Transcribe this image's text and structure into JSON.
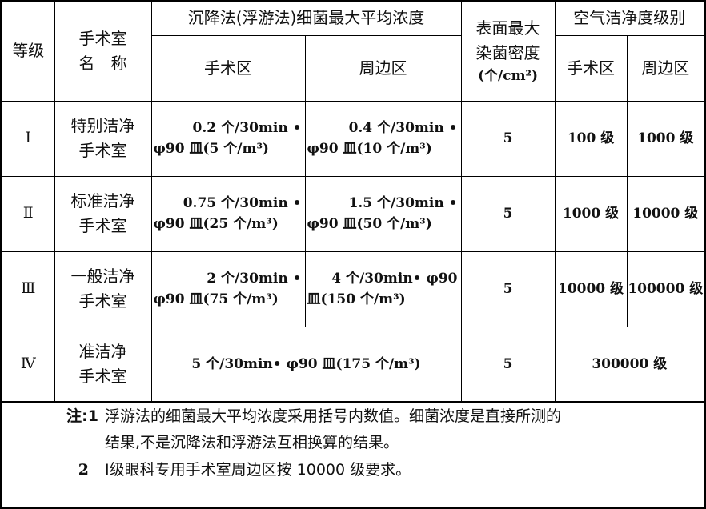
{
  "header": {
    "grade": "等级",
    "room_name_line1": "手术室",
    "room_name_line2": "名　称",
    "bacteria_conc": "沉降法(浮游法)细菌最大平均浓度",
    "op_zone": "手术区",
    "peri_zone": "周边区",
    "surface_line1": "表面最大",
    "surface_line2": "染菌密度",
    "surface_unit": "(个/cm²)",
    "air_clean": "空气洁净度级别",
    "air_op": "手术区",
    "air_peri": "周边区"
  },
  "rows": [
    {
      "grade": "Ⅰ",
      "name_line1": "特别洁净",
      "name_line2": "手术室",
      "op_line1": "0.2 个/30min •",
      "op_line2": "φ90 皿(5 个/m³)",
      "peri_line1": "0.4 个/30min •",
      "peri_line2": "φ90 皿(10 个/m³)",
      "surface": "5",
      "air_op": "100 级",
      "air_peri": "1000 级"
    },
    {
      "grade": "Ⅱ",
      "name_line1": "标准洁净",
      "name_line2": "手术室",
      "op_line1": "0.75 个/30min •",
      "op_line2": "φ90 皿(25 个/m³)",
      "peri_line1": "1.5 个/30min •",
      "peri_line2": "φ90 皿(50 个/m³)",
      "surface": "5",
      "air_op": "1000 级",
      "air_peri": "10000 级"
    },
    {
      "grade": "Ⅲ",
      "name_line1": "一般洁净",
      "name_line2": "手术室",
      "op_line1": "2 个/30min •",
      "op_line2": "φ90 皿(75 个/m³)",
      "peri_line1": "4 个/30min• φ90",
      "peri_line2": "皿(150 个/m³)",
      "surface": "5",
      "air_op": "10000 级",
      "air_peri": "100000 级"
    },
    {
      "grade": "Ⅳ",
      "name_line1": "准洁净",
      "name_line2": "手术室",
      "merged_conc": "5 个/30min• φ90 皿(175 个/m³)",
      "surface": "5",
      "air_merged": "300000 级"
    }
  ],
  "notes": {
    "prefix": "注:1",
    "note1_line1": "浮游法的细菌最大平均浓度采用括号内数值。细菌浓度是直接所测的",
    "note1_line2": "结果,不是沉降法和浮游法互相换算的结果。",
    "num2": "2",
    "note2": "Ⅰ级眼科专用手术室周边区按 10000 级要求。"
  }
}
